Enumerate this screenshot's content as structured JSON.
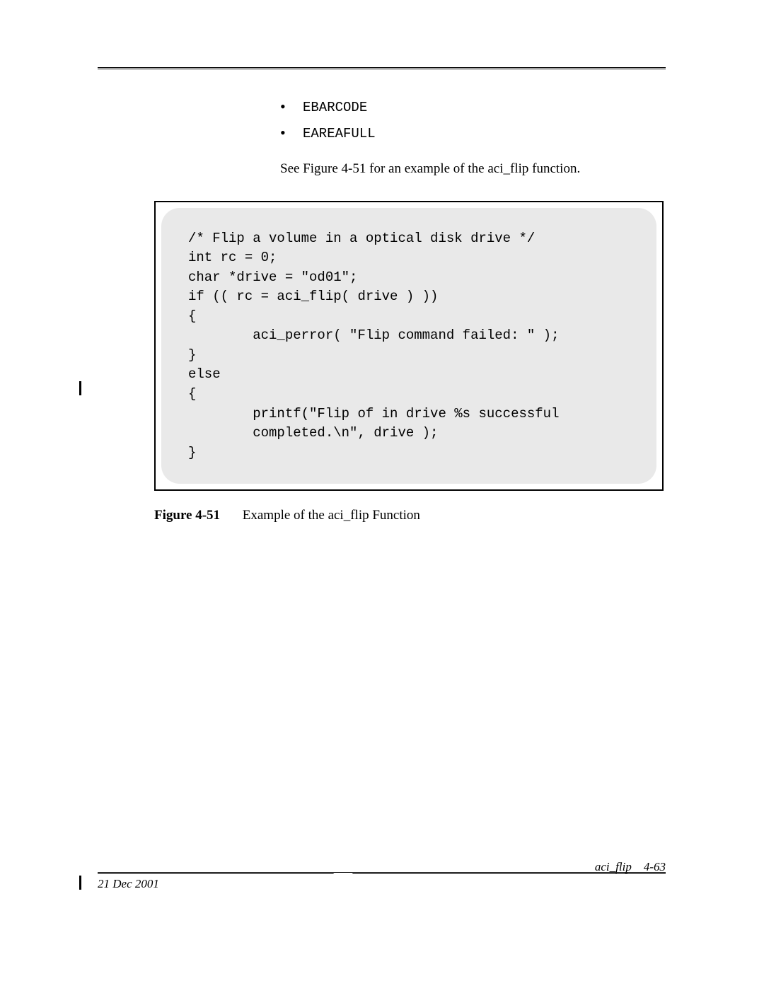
{
  "bullets": {
    "b1": "EBARCODE",
    "b2": "EAREAFULL"
  },
  "ref": "See Figure 4-51 for an example of the aci_flip function.",
  "code": "/* Flip a volume in a optical disk drive */\nint rc = 0;\nchar *drive = \"od01\";\nif (( rc = aci_flip( drive ) ))\n{\n        aci_perror( \"Flip command failed: \" );\n}\nelse\n{\n        printf(\"Flip of in drive %s successful\n        completed.\\n\", drive );\n}",
  "fig": {
    "label": "Figure 4-51",
    "caption": "Example of the aci_flip Function"
  },
  "footer": {
    "date": "21 Dec 2001",
    "section": "aci_flip",
    "page": "4-63"
  }
}
